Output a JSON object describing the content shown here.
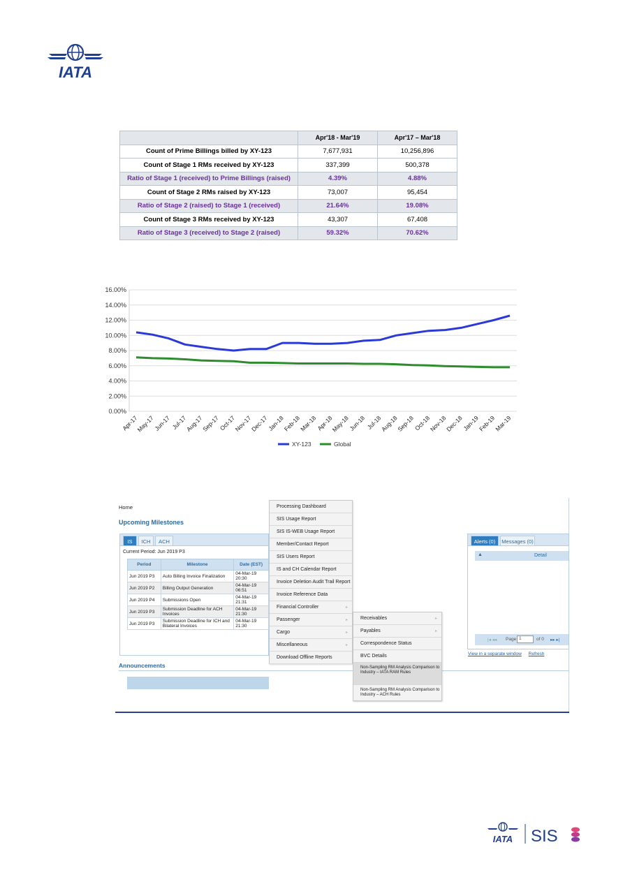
{
  "logos": {
    "top": "IATA",
    "bottom_iata": "IATA",
    "bottom_sis": "SIS"
  },
  "stats_table": {
    "headers": [
      "",
      "Apr'18 - Mar'19",
      "Apr'17 – Mar'18"
    ],
    "rows": [
      {
        "label": "Count of Prime Billings billed by XY-123",
        "a": "7,677,931",
        "b": "10,256,896",
        "ratio": false
      },
      {
        "label": "Count of Stage 1 RMs received by XY-123",
        "a": "337,399",
        "b": "500,378",
        "ratio": false
      },
      {
        "label": "Ratio of Stage 1 (received) to Prime Billings (raised)",
        "a": "4.39%",
        "b": "4.88%",
        "ratio": true
      },
      {
        "label": "Count of Stage 2 RMs raised by XY-123",
        "a": "73,007",
        "b": "95,454",
        "ratio": false
      },
      {
        "label": "Ratio of Stage 2 (raised) to Stage 1 (received)",
        "a": "21.64%",
        "b": "19.08%",
        "ratio": true
      },
      {
        "label": "Count of Stage 3 RMs received by XY-123",
        "a": "43,307",
        "b": "67,408",
        "ratio": false
      },
      {
        "label": "Ratio of Stage 3 (received) to Stage 2 (raised)",
        "a": "59.32%",
        "b": "70.62%",
        "ratio": true
      }
    ]
  },
  "chart_data": {
    "type": "line",
    "title": "",
    "xlabel": "",
    "ylabel": "",
    "x": [
      "Apr-17",
      "May-17",
      "Jun-17",
      "Jul-17",
      "Aug-17",
      "Sep-17",
      "Oct-17",
      "Nov-17",
      "Dec-17",
      "Jan-18",
      "Feb-18",
      "Mar-18",
      "Apr-18",
      "May-18",
      "Jun-18",
      "Jul-18",
      "Aug-18",
      "Sep-18",
      "Oct-18",
      "Nov-18",
      "Dec-18",
      "Jan-19",
      "Feb-19",
      "Mar-19"
    ],
    "ylim": [
      0,
      16
    ],
    "yticks": [
      "0.00%",
      "2.00%",
      "4.00%",
      "6.00%",
      "8.00%",
      "10.00%",
      "12.00%",
      "14.00%",
      "16.00%"
    ],
    "series": [
      {
        "name": "XY-123",
        "color": "#2b3ad6",
        "values": [
          10.4,
          10.1,
          9.6,
          8.8,
          8.5,
          8.2,
          8.0,
          8.2,
          8.2,
          9.0,
          9.0,
          8.9,
          8.9,
          9.0,
          9.3,
          9.4,
          10.0,
          10.3,
          10.6,
          10.7,
          11.0,
          11.5,
          12.0,
          12.6
        ]
      },
      {
        "name": "Global",
        "color": "#2e8b2e",
        "values": [
          7.1,
          7.0,
          6.95,
          6.85,
          6.7,
          6.65,
          6.6,
          6.4,
          6.4,
          6.35,
          6.3,
          6.3,
          6.3,
          6.3,
          6.25,
          6.25,
          6.2,
          6.1,
          6.05,
          5.95,
          5.9,
          5.85,
          5.8,
          5.8
        ]
      }
    ],
    "grid": true,
    "legend": "bottom-center"
  },
  "app": {
    "home": "Home",
    "milestones_title": "Upcoming Milestones",
    "tabs": [
      "IS",
      "ICH",
      "ACH"
    ],
    "current_period": "Current Period: Jun 2019 P3",
    "table_headers": [
      "Period",
      "Milestone",
      "Date (EST)"
    ],
    "rows": [
      {
        "period": "Jun 2019 P3",
        "milestone": "Auto Billing Invoice Finalization",
        "date": "04-Mar-19 20:30"
      },
      {
        "period": "Jun 2019 P2",
        "milestone": "Billing Output Generation",
        "date": "04-Mar-19 06:51"
      },
      {
        "period": "Jun 2019 P4",
        "milestone": "Submissions Open",
        "date": "04-Mar-19 21:31"
      },
      {
        "period": "Jun 2019 P3",
        "milestone": "Submission Deadline for ACH Invoices",
        "date": "04-Mar-19 21:30"
      },
      {
        "period": "Jun 2019 P3",
        "milestone": "Submission Deadline for ICH and Bilateral Invoices",
        "date": "04-Mar-19 21:30"
      }
    ],
    "menu": [
      "Processing Dashboard",
      "SIS Usage Report",
      "SIS IS-WEB Usage Report",
      "Member/Contact Report",
      "SIS Users Report",
      "IS and CH Calendar Report",
      "Invoice Deletion Audit Trail Report",
      "Invoice Reference Data",
      "Financial Controller",
      "Passenger",
      "Cargo",
      "Miscellaneous",
      "Download Offline Reports"
    ],
    "submenu": [
      "Receivables",
      "Payables",
      "Correspondence Status",
      "BVC Details",
      "Non-Sampling RM Analysis Comparison to Industry – IATA RAM Rules",
      "Non-Sampling RM Analysis Comparison to Industry – ACH Rules"
    ],
    "alerts_tabs": [
      "Alerts (0)",
      "Messages (0)"
    ],
    "alerts_detail": "Detail",
    "pager_page": "Page",
    "pager_value": "1",
    "pager_of": "of 0",
    "link_window": "View in a separate window",
    "link_refresh": "Refresh",
    "announcements": "Announcements"
  }
}
